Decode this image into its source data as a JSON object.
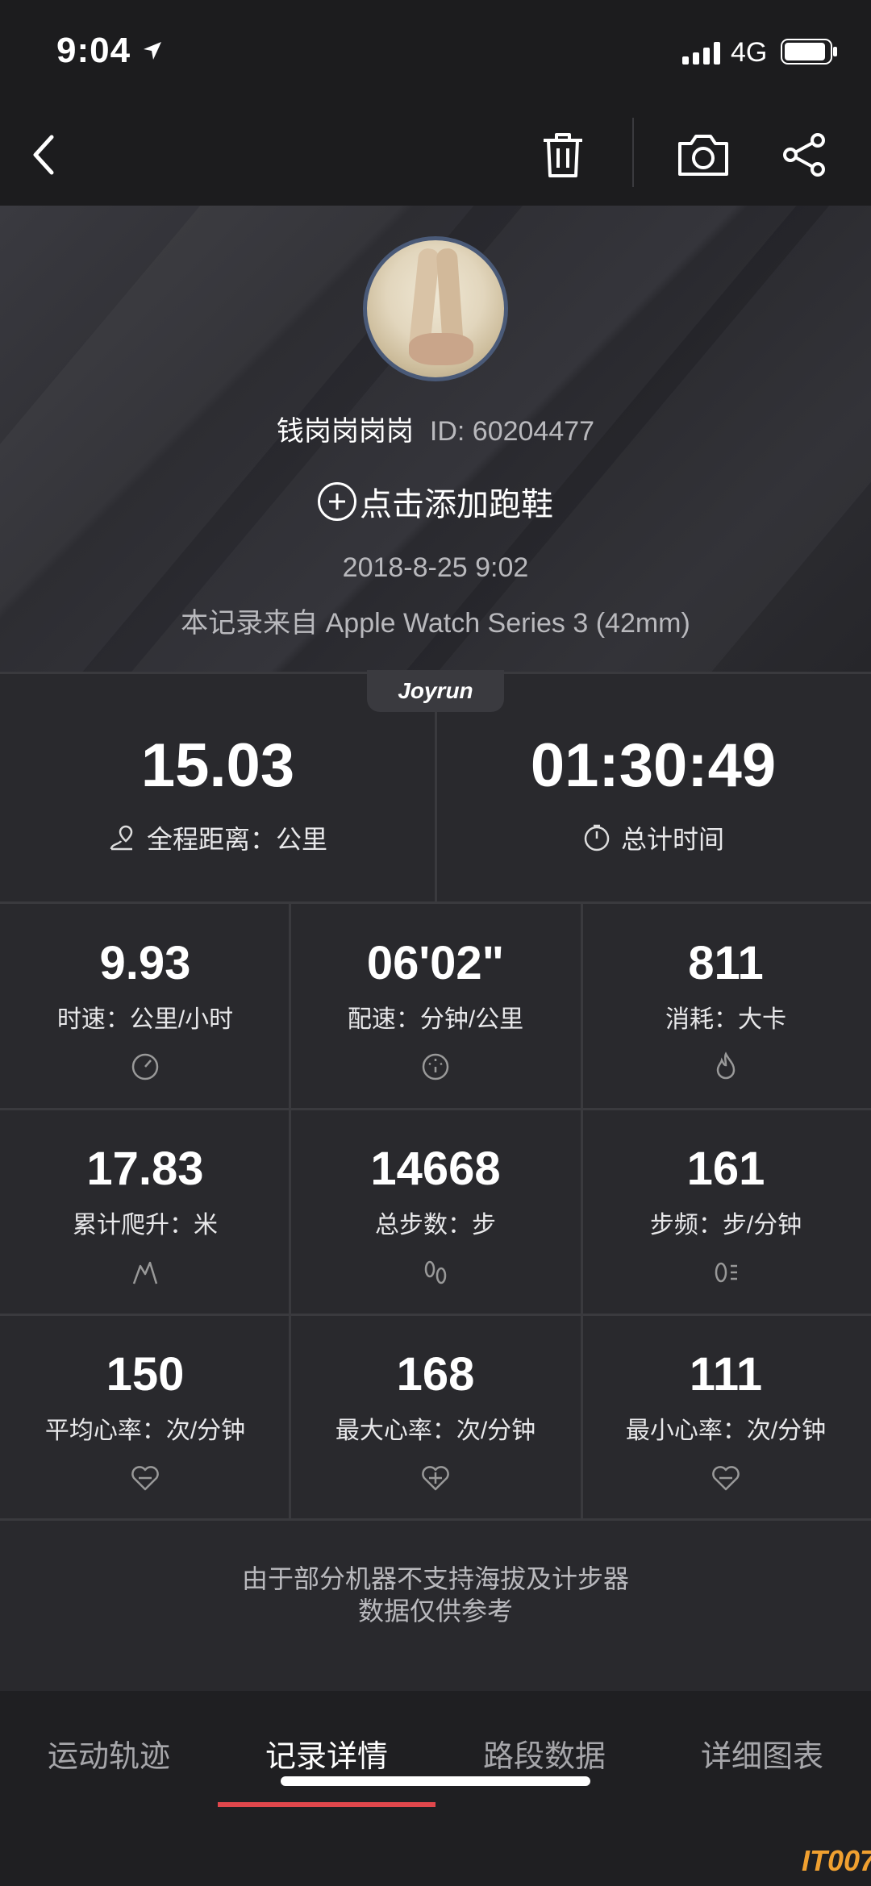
{
  "status_bar": {
    "time": "9:04",
    "network": "4G"
  },
  "navbar": {
    "back": "back-icon",
    "delete": "trash-icon",
    "camera": "camera-icon",
    "share": "share-icon"
  },
  "profile": {
    "name": "钱岗岗岗岗",
    "user_id": "ID: 60204477",
    "add_shoe": "点击添加跑鞋",
    "date": "2018-8-25 9:02",
    "source": "本记录来自 Apple Watch Series 3 (42mm)"
  },
  "badge": "Joyrun",
  "summary": [
    {
      "value": "15.03",
      "label": "全程距离：公里",
      "icon": "route-icon"
    },
    {
      "value": "01:30:49",
      "label": "总计时间",
      "icon": "stopwatch-icon"
    }
  ],
  "metrics": [
    {
      "value": "9.93",
      "label": "时速：公里/小时",
      "icon": "speedometer-icon"
    },
    {
      "value": "06'02\"",
      "label": "配速：分钟/公里",
      "icon": "pace-gauge-icon"
    },
    {
      "value": "811",
      "label": "消耗：大卡",
      "icon": "flame-icon"
    },
    {
      "value": "17.83",
      "label": "累计爬升：米",
      "icon": "climb-icon"
    },
    {
      "value": "14668",
      "label": "总步数：步",
      "icon": "footprints-icon"
    },
    {
      "value": "161",
      "label": "步频：步/分钟",
      "icon": "cadence-icon"
    },
    {
      "value": "150",
      "label": "平均心率：次/分钟",
      "icon": "heart-avg-icon"
    },
    {
      "value": "168",
      "label": "最大心率：次/分钟",
      "icon": "heart-max-icon"
    },
    {
      "value": "111",
      "label": "最小心率：次/分钟",
      "icon": "heart-min-icon"
    }
  ],
  "note": {
    "line1": "由于部分机器不支持海拔及计步器",
    "line2": "数据仅供参考"
  },
  "tabs": [
    {
      "label": "运动轨迹"
    },
    {
      "label": "记录详情"
    },
    {
      "label": "路段数据"
    },
    {
      "label": "详细图表"
    }
  ],
  "watermark": "IT007",
  "colors": {
    "accent": "#e0474c",
    "background": "#29292d"
  }
}
